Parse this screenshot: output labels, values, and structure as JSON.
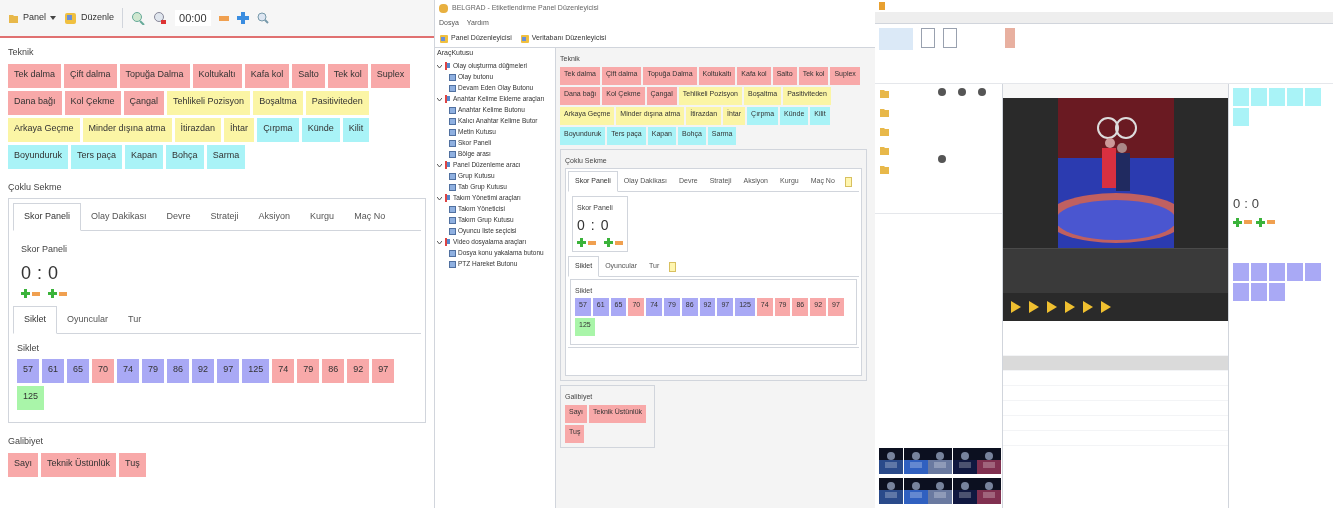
{
  "left_window": {
    "toolbar": [
      {
        "kind": "dropdown",
        "label": "Panel"
      },
      {
        "kind": "edit",
        "label": "Düzenle"
      },
      {
        "kind": "time",
        "label": "00:00"
      }
    ],
    "panel": {
      "teknik": {
        "title": "Teknik",
        "chips": [
          {
            "label": "Tek dalma",
            "color": "#f8a9a9"
          },
          {
            "label": "Çift dalma",
            "color": "#f8a9a9"
          },
          {
            "label": "Topuğa Dalma",
            "color": "#f8a9a9"
          },
          {
            "label": "Koltukaltı",
            "color": "#f8a9a9"
          },
          {
            "label": "Kafa kol",
            "color": "#f8a9a9"
          },
          {
            "label": "Salto",
            "color": "#f8a9a9"
          },
          {
            "label": "Tek kol",
            "color": "#f8a9a9"
          },
          {
            "label": "Suplex",
            "color": "#f8a9a9"
          },
          {
            "label": "Dana bağı",
            "color": "#f8a9a9"
          },
          {
            "label": "Kol Çekme",
            "color": "#f8a9a9"
          },
          {
            "label": "Çangal",
            "color": "#f8a9a9"
          },
          {
            "label": "Tehlikeli Pozisyon",
            "color": "#fbf5a5"
          },
          {
            "label": "Boşaltma",
            "color": "#fbf5a5"
          },
          {
            "label": "Pasitiviteden",
            "color": "#fbf5a5"
          },
          {
            "label": "Arkaya Geçme",
            "color": "#fbf5a5"
          },
          {
            "label": "Minder dışına atma",
            "color": "#fbf5a5"
          },
          {
            "label": "İtirazdan",
            "color": "#fbf5a5"
          },
          {
            "label": "İhtar",
            "color": "#fbf5a5"
          },
          {
            "label": "Çırpma",
            "color": "#a9f3f7"
          },
          {
            "label": "Künde",
            "color": "#a9f3f7"
          },
          {
            "label": "Kilit",
            "color": "#a9f3f7"
          },
          {
            "label": "Boyunduruk",
            "color": "#a9f3f7"
          },
          {
            "label": "Ters paça",
            "color": "#a9f3f7"
          },
          {
            "label": "Kapan",
            "color": "#a9f3f7"
          },
          {
            "label": "Bohça",
            "color": "#a9f3f7"
          },
          {
            "label": "Sarma",
            "color": "#a9f3f7"
          }
        ]
      },
      "multi_tab": {
        "title": "Çoklu Sekme",
        "tabs": [
          {
            "label": "Skor Paneli",
            "selected": true
          },
          {
            "label": "Olay Dakikası",
            "selected": false
          },
          {
            "label": "Devre",
            "selected": false
          },
          {
            "label": "Strateji",
            "selected": false
          },
          {
            "label": "Aksiyon",
            "selected": false
          },
          {
            "label": "Kurgu",
            "selected": false
          },
          {
            "label": "Maç No",
            "selected": false
          }
        ],
        "score": {
          "title": "Skor Paneli",
          "home": "0",
          "separator": ":",
          "away": "0"
        },
        "subtabs": [
          {
            "label": "Siklet",
            "selected": true
          },
          {
            "label": "Oyuncular",
            "selected": false
          },
          {
            "label": "Tur",
            "selected": false
          }
        ],
        "siklet": {
          "title": "Siklet",
          "chips": [
            {
              "label": "57",
              "color": "#a9a9f5"
            },
            {
              "label": "61",
              "color": "#a9a9f5"
            },
            {
              "label": "65",
              "color": "#a9a9f5"
            },
            {
              "label": "70",
              "color": "#f8a9a9"
            },
            {
              "label": "74",
              "color": "#a9a9f5"
            },
            {
              "label": "79",
              "color": "#a9a9f5"
            },
            {
              "label": "86",
              "color": "#a9a9f5"
            },
            {
              "label": "92",
              "color": "#a9a9f5"
            },
            {
              "label": "97",
              "color": "#a9a9f5"
            },
            {
              "label": "125",
              "color": "#a9a9f5"
            },
            {
              "label": "74",
              "color": "#f8a9a9"
            },
            {
              "label": "79",
              "color": "#f8a9a9"
            },
            {
              "label": "86",
              "color": "#f8a9a9"
            },
            {
              "label": "92",
              "color": "#f8a9a9"
            },
            {
              "label": "97",
              "color": "#f8a9a9"
            },
            {
              "label": "125",
              "color": "#a9f5a9"
            }
          ]
        }
      },
      "galibiyet": {
        "title": "Galibiyet",
        "chips": [
          {
            "label": "Sayı",
            "color": "#f8a9a9"
          },
          {
            "label": "Teknik Üstünlük",
            "color": "#f8a9a9"
          },
          {
            "label": "Tuş",
            "color": "#f8a9a9"
          }
        ]
      }
    }
  },
  "editor_window": {
    "title": "BELGRAD - Etiketlendirme Panel Düzenleyicisi",
    "menu": [
      "Dosya",
      "Yardım"
    ],
    "toolbar": [
      "Panel Düzenleyicisi",
      "Veritabanı Düzenleyicisi"
    ],
    "toolbox": {
      "title": "AraçKutusu",
      "groups": [
        {
          "label": "Olay oluşturma düğmeleri",
          "expanded": true,
          "children": [
            "Olay butonu",
            "Devam Eden Olay Butonu"
          ]
        },
        {
          "label": "Anahtar Kelime Ekleme araçları",
          "expanded": true,
          "children": [
            "Anahtar Kelime Butonu",
            "Kalıcı Anahtar Kelime Butor",
            "Metin Kutusu",
            "Skor Paneli",
            "Bölge arası"
          ]
        },
        {
          "label": "Panel Düzenleme aracı",
          "expanded": true,
          "children": [
            "Grup Kutusu",
            "Tab Grup Kutusu"
          ]
        },
        {
          "label": "Takım Yönetimi araçları",
          "expanded": true,
          "children": [
            "Takım Yöneticisi",
            "Takım Grup Kutusu",
            "Oyuncu liste seçicisi"
          ]
        },
        {
          "label": "Video dosyalama araçları",
          "expanded": true,
          "children": [
            "Dosya konu yakalama butonu",
            "PTZ Hareket Butonu"
          ]
        }
      ]
    },
    "panel": {
      "teknik": {
        "title": "Teknik",
        "chips": [
          {
            "label": "Tek dalma",
            "color": "#f8a9a9"
          },
          {
            "label": "Çift dalma",
            "color": "#f8a9a9"
          },
          {
            "label": "Topuğa Dalma",
            "color": "#f8a9a9"
          },
          {
            "label": "Koltukaltı",
            "color": "#f8a9a9"
          },
          {
            "label": "Kafa kol",
            "color": "#f8a9a9"
          },
          {
            "label": "Salto",
            "color": "#f8a9a9"
          },
          {
            "label": "Tek kol",
            "color": "#f8a9a9"
          },
          {
            "label": "Suplex",
            "color": "#f8a9a9"
          },
          {
            "label": "Dana bağı",
            "color": "#f8a9a9"
          },
          {
            "label": "Kol Çekme",
            "color": "#f8a9a9"
          },
          {
            "label": "Çangal",
            "color": "#f8a9a9"
          },
          {
            "label": "Tehlikeli Pozisyon",
            "color": "#fbf5a5"
          },
          {
            "label": "Boşaltma",
            "color": "#fbf5a5"
          },
          {
            "label": "Pasitiviteden",
            "color": "#fbf5a5"
          },
          {
            "label": "Arkaya Geçme",
            "color": "#fbf5a5"
          },
          {
            "label": "Minder dışına atma",
            "color": "#fbf5a5"
          },
          {
            "label": "İtirazdan",
            "color": "#fbf5a5"
          },
          {
            "label": "İhtar",
            "color": "#fbf5a5"
          },
          {
            "label": "Çırpma",
            "color": "#a9f3f7"
          },
          {
            "label": "Künde",
            "color": "#a9f3f7"
          },
          {
            "label": "Kilit",
            "color": "#a9f3f7"
          },
          {
            "label": "Boyunduruk",
            "color": "#a9f3f7"
          },
          {
            "label": "Ters paça",
            "color": "#a9f3f7"
          },
          {
            "label": "Kapan",
            "color": "#a9f3f7"
          },
          {
            "label": "Bohça",
            "color": "#a9f3f7"
          },
          {
            "label": "Sarma",
            "color": "#a9f3f7"
          }
        ]
      },
      "multi_tab": {
        "title": "Çoklu Sekme",
        "tabs": [
          {
            "label": "Skor Paneli",
            "selected": true
          },
          {
            "label": "Olay Dakikası",
            "selected": false
          },
          {
            "label": "Devre",
            "selected": false
          },
          {
            "label": "Strateji",
            "selected": false
          },
          {
            "label": "Aksiyon",
            "selected": false
          },
          {
            "label": "Kurgu",
            "selected": false
          },
          {
            "label": "Maç No",
            "selected": false
          }
        ],
        "score": {
          "title": "Skor Paneli",
          "home": "0",
          "separator": ":",
          "away": "0"
        },
        "subtabs": [
          {
            "label": "Siklet",
            "selected": true
          },
          {
            "label": "Oyuncular",
            "selected": false
          },
          {
            "label": "Tur",
            "selected": false
          }
        ],
        "siklet": {
          "title": "Siklet",
          "chips": [
            {
              "label": "57",
              "color": "#a9a9f5"
            },
            {
              "label": "61",
              "color": "#a9a9f5"
            },
            {
              "label": "65",
              "color": "#a9a9f5"
            },
            {
              "label": "70",
              "color": "#f8a9a9"
            },
            {
              "label": "74",
              "color": "#a9a9f5"
            },
            {
              "label": "79",
              "color": "#a9a9f5"
            },
            {
              "label": "86",
              "color": "#a9a9f5"
            },
            {
              "label": "92",
              "color": "#a9a9f5"
            },
            {
              "label": "97",
              "color": "#a9a9f5"
            },
            {
              "label": "125",
              "color": "#a9a9f5"
            },
            {
              "label": "74",
              "color": "#f8a9a9"
            },
            {
              "label": "79",
              "color": "#f8a9a9"
            },
            {
              "label": "86",
              "color": "#f8a9a9"
            },
            {
              "label": "92",
              "color": "#f8a9a9"
            },
            {
              "label": "97",
              "color": "#f8a9a9"
            },
            {
              "label": "125",
              "color": "#a9f5a9"
            }
          ]
        }
      },
      "galibiyet": {
        "title": "Galibiyet",
        "chips": [
          {
            "label": "Sayı",
            "color": "#f8a9a9"
          },
          {
            "label": "Teknik Üstünlük",
            "color": "#f8a9a9"
          },
          {
            "label": "Tuş",
            "color": "#f8a9a9"
          }
        ]
      }
    }
  },
  "media_window": {
    "score": {
      "home": "0",
      "separator": ":",
      "away": "0"
    },
    "top_chips": [
      {
        "color": "#a9f3f7"
      },
      {
        "color": "#a9f3f7"
      },
      {
        "color": "#a9f3f7"
      },
      {
        "color": "#a9f3f7"
      },
      {
        "color": "#a9f3f7"
      },
      {
        "color": "#a9f3f7"
      }
    ],
    "bottom_chips": [
      {
        "color": "#a9a9f5"
      },
      {
        "color": "#a9a9f5"
      },
      {
        "color": "#a9a9f5"
      },
      {
        "color": "#a9a9f5"
      },
      {
        "color": "#a9a9f5"
      },
      {
        "color": "#a9a9f5"
      },
      {
        "color": "#a9a9f5"
      },
      {
        "color": "#a9a9f5"
      }
    ],
    "rows": [
      {
        "selected": false
      },
      {
        "selected": true
      },
      {
        "selected": false
      },
      {
        "selected": false
      },
      {
        "selected": false
      },
      {
        "selected": false
      },
      {
        "selected": false
      }
    ]
  }
}
